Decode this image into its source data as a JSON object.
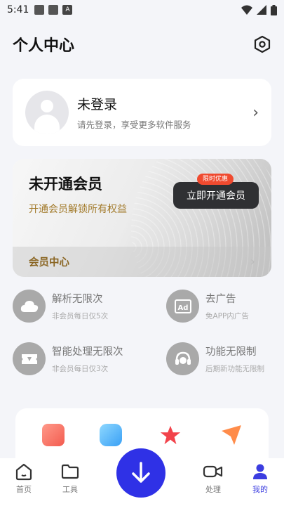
{
  "status_bar": {
    "time": "5:41",
    "a_icon": "A"
  },
  "header": {
    "title": "个人中心",
    "settings_icon": "hexagon-settings-icon"
  },
  "login": {
    "title": "未登录",
    "subtitle": "请先登录，享受更多软件服务",
    "chevron": "›"
  },
  "vip": {
    "title": "未开通会员",
    "subtitle": "开通会员解锁所有权益",
    "badge": "限时优惠",
    "button": "立即开通会员",
    "footer": "会员中心",
    "footer_chevron": "›"
  },
  "benefits": [
    {
      "title": "解析无限次",
      "sub": "非会员每日仅5次",
      "icon": "cloud-icon"
    },
    {
      "title": "去广告",
      "sub": "免APP内广告",
      "icon": "ad-icon"
    },
    {
      "title": "智能处理无限次",
      "sub": "非会员每日仅3次",
      "icon": "ticket-icon"
    },
    {
      "title": "功能无限制",
      "sub": "后期新功能无限制",
      "icon": "headset-icon"
    }
  ],
  "tabs": [
    {
      "label": "首页",
      "icon": "home-icon"
    },
    {
      "label": "工具",
      "icon": "folder-icon"
    },
    {
      "label": "处理",
      "icon": "video-icon"
    },
    {
      "label": "我的",
      "icon": "user-icon"
    }
  ],
  "colors": {
    "accent": "#2f31e6",
    "gold": "#a27a2a",
    "badge": "#f04a2f"
  }
}
